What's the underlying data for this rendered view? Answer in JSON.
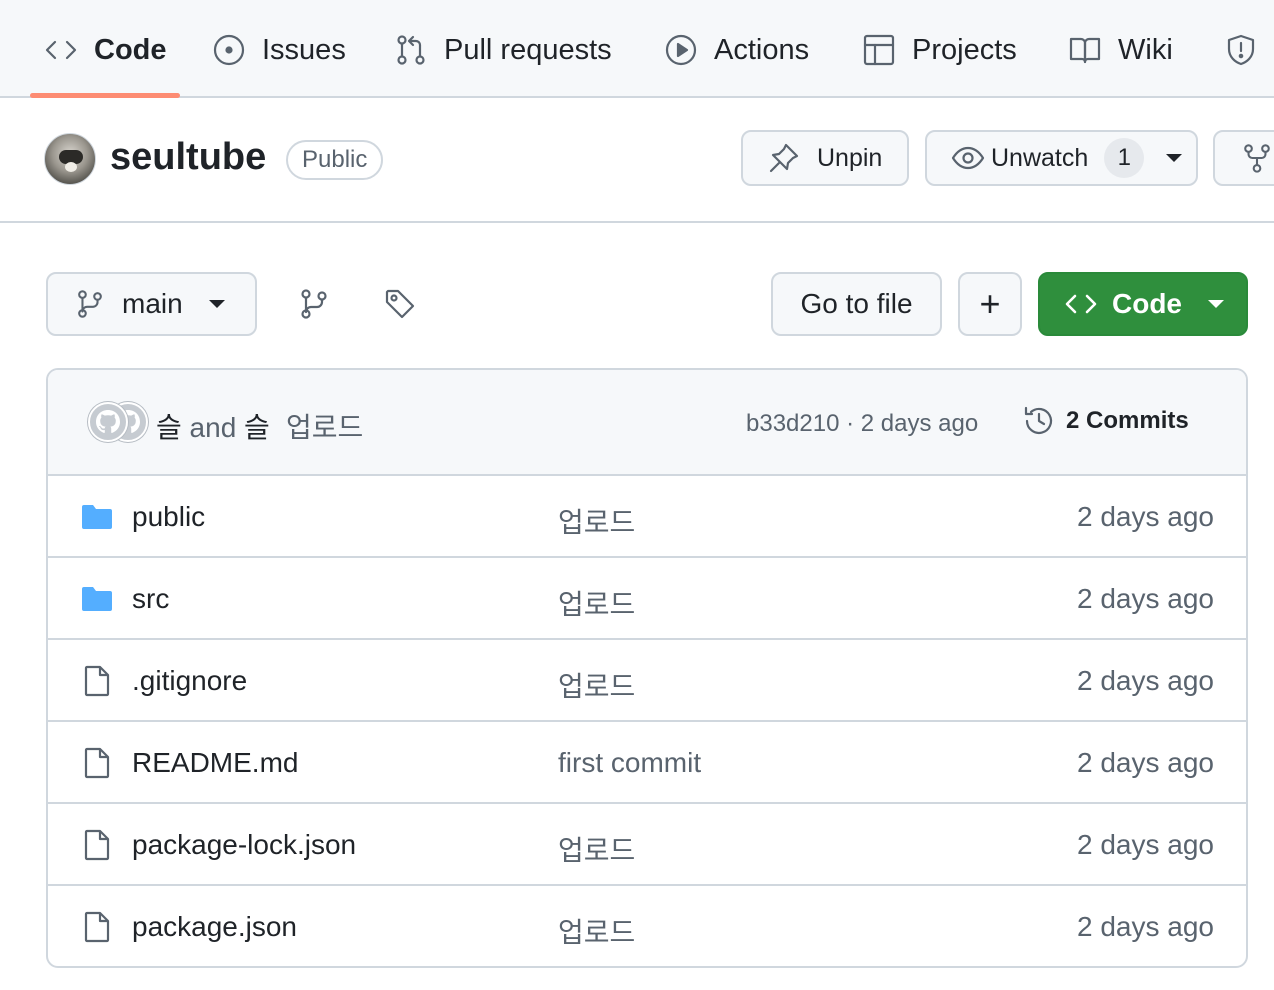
{
  "nav": {
    "tabs": [
      {
        "label": "Code",
        "icon": "code-icon",
        "active": true
      },
      {
        "label": "Issues",
        "icon": "issue-opened-icon"
      },
      {
        "label": "Pull requests",
        "icon": "git-pull-request-icon"
      },
      {
        "label": "Actions",
        "icon": "play-icon"
      },
      {
        "label": "Projects",
        "icon": "table-icon"
      },
      {
        "label": "Wiki",
        "icon": "book-icon"
      }
    ],
    "security_icon": "shield-icon",
    "underline_color": "#fd8c73"
  },
  "repo": {
    "name": "seultube",
    "visibility": "Public",
    "unpin_label": "Unpin",
    "unwatch_label": "Unwatch",
    "watch_count": "1"
  },
  "toolbar": {
    "branch": "main",
    "go_to_file": "Go to file",
    "add_label": "+",
    "code_label": "Code",
    "code_button_color": "#2f8f3d"
  },
  "commit": {
    "author1": "슬",
    "and": "and",
    "author2": "슬",
    "message": "업로드",
    "meta": "b33d210 · 2 days ago",
    "commits_label": "2 Commits"
  },
  "files": [
    {
      "name": "public",
      "type": "folder",
      "message": "업로드",
      "date": "2 days ago"
    },
    {
      "name": "src",
      "type": "folder",
      "message": "업로드",
      "date": "2 days ago"
    },
    {
      "name": ".gitignore",
      "type": "file",
      "message": "업로드",
      "date": "2 days ago"
    },
    {
      "name": "README.md",
      "type": "file",
      "message": "first commit",
      "date": "2 days ago"
    },
    {
      "name": "package-lock.json",
      "type": "file",
      "message": "업로드",
      "date": "2 days ago"
    },
    {
      "name": "package.json",
      "type": "file",
      "message": "업로드",
      "date": "2 days ago"
    }
  ]
}
